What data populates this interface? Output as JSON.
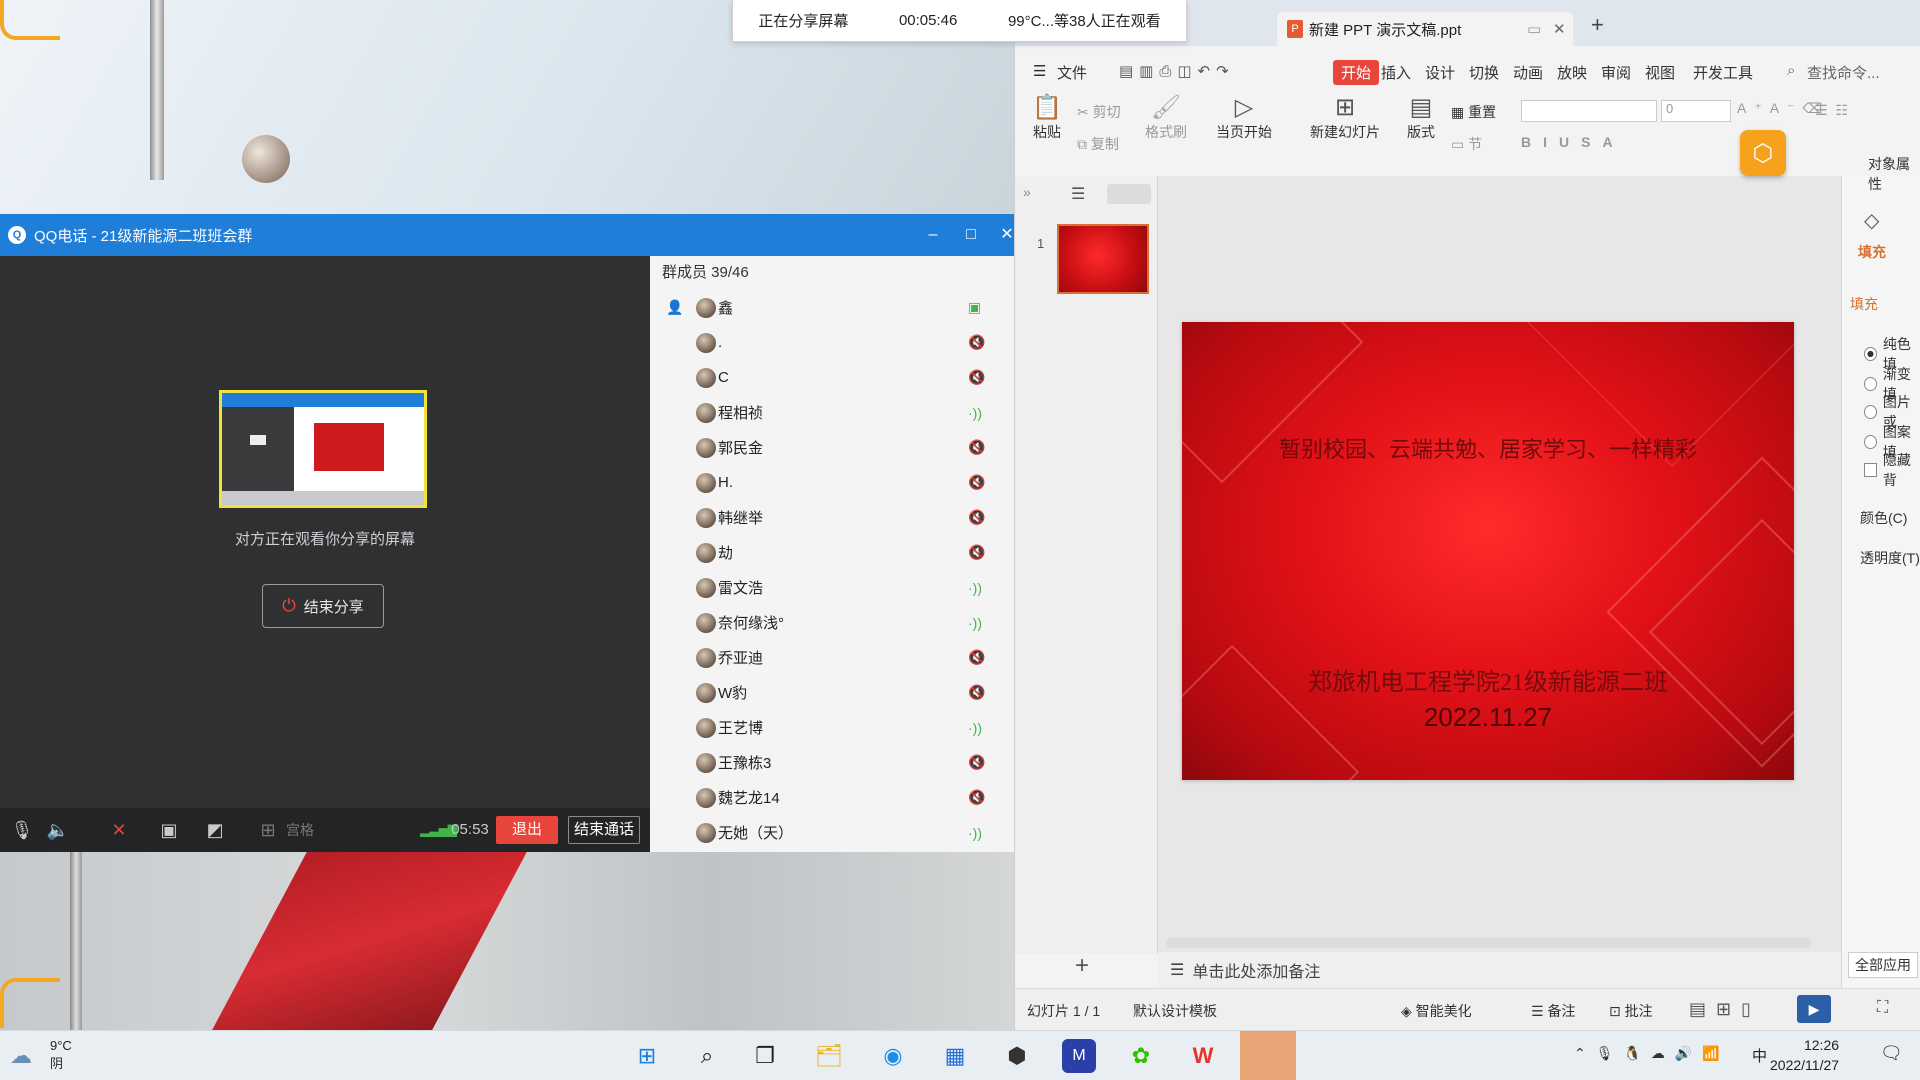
{
  "share_banner": {
    "status": "正在分享屏幕",
    "time": "00:05:46",
    "viewers": "99°C...等38人正在观看"
  },
  "qq": {
    "title": "QQ电话 - 21级新能源二班班会群",
    "watching": "对方正在观看你分享的屏幕",
    "end_share": "结束分享",
    "grid_label": "宫格",
    "call_time": "05:53",
    "exit": "退出",
    "end_call": "结束通话",
    "member_count": "群成员 39/46",
    "members": [
      {
        "name": "鑫",
        "status": "screen"
      },
      {
        "name": ".",
        "status": "muted"
      },
      {
        "name": "C",
        "status": "muted"
      },
      {
        "name": "程相祯",
        "status": "speaking"
      },
      {
        "name": "郭民金",
        "status": "muted"
      },
      {
        "name": "H.",
        "status": "muted"
      },
      {
        "name": "韩继举",
        "status": "muted"
      },
      {
        "name": "劫",
        "status": "muted"
      },
      {
        "name": "雷文浩",
        "status": "speaking"
      },
      {
        "name": "奈何缘浅°",
        "status": "speaking"
      },
      {
        "name": "乔亚迪",
        "status": "muted"
      },
      {
        "name": "W豹",
        "status": "muted"
      },
      {
        "name": "王艺博",
        "status": "speaking"
      },
      {
        "name": "王豫栋3",
        "status": "muted"
      },
      {
        "name": "魏艺龙14",
        "status": "muted"
      },
      {
        "name": "无她（天）",
        "status": "speaking"
      }
    ]
  },
  "wps": {
    "doc_title": "新建 PPT 演示文稿.ppt",
    "menu": [
      "文件",
      "开始",
      "插入",
      "设计",
      "切换",
      "动画",
      "放映",
      "审阅",
      "视图",
      "开发工具"
    ],
    "search": "查找命令...",
    "ribbon": {
      "paste": "粘贴",
      "cut": "剪切",
      "copy": "复制",
      "format_painter": "格式刷",
      "from_current": "当页开始",
      "new_slide": "新建幻灯片",
      "layout": "版式",
      "reset": "重置",
      "section": "节",
      "font_size": "0"
    },
    "slide_number": "1",
    "slide": {
      "line1": "暂别校园、云端共勉、居家学习、一样精彩",
      "line2": "郑旅机电工程学院21级新能源二班",
      "line3": "2022.11.27"
    },
    "notes": "单击此处添加备注",
    "status": {
      "slide_count": "幻灯片 1 / 1",
      "template": "默认设计模板",
      "beautify": "智能美化",
      "notes": "备注",
      "comment": "批注"
    },
    "props": {
      "title": "对象属性",
      "fill_tab": "填充",
      "fill_section": "填充",
      "options": [
        "纯色填",
        "渐变填",
        "图片或",
        "图案填"
      ],
      "hide": "隐藏背",
      "color": "颜色(C)",
      "transparency": "透明度(T)",
      "apply_all": "全部应用"
    }
  },
  "taskbar": {
    "weather_temp": "9°C",
    "weather_desc": "阴",
    "time": "12:26",
    "date": "2022/11/27",
    "ime": "中"
  }
}
